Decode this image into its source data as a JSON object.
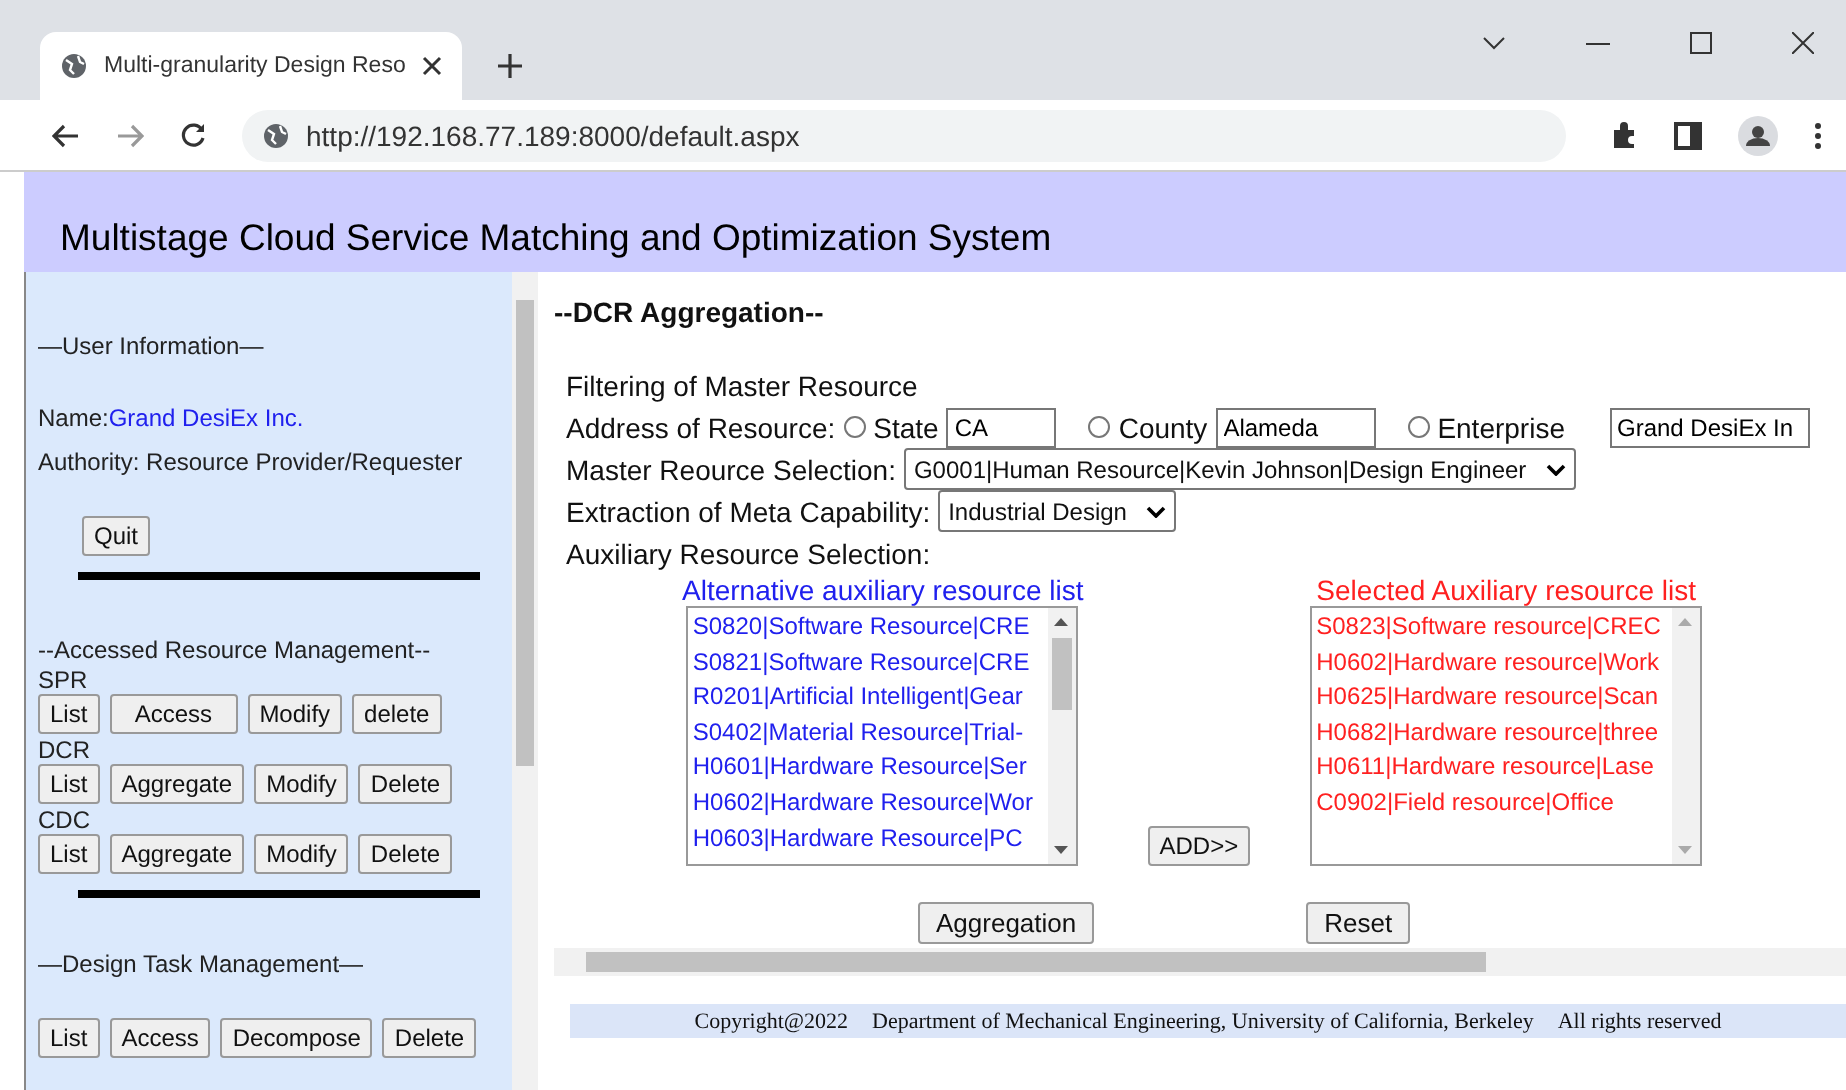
{
  "browser": {
    "tab_title": "Multi-granularity Design Reso",
    "url": "http://192.168.77.189:8000/default.aspx"
  },
  "header": {
    "title": "Multistage Cloud Service Matching and Optimization System"
  },
  "sidebar": {
    "user_heading": "—User Information—",
    "name_label": "Name:",
    "name_value": "Grand DesiEx Inc.",
    "authority": "Authority: Resource Provider/Requester",
    "quit": "Quit",
    "resource_heading": "--Accessed Resource Management--",
    "groups": [
      {
        "label": "SPR",
        "buttons": [
          "List",
          "Access",
          "Modify",
          "delete"
        ]
      },
      {
        "label": "DCR",
        "buttons": [
          "List",
          "Aggregate",
          "Modify",
          "Delete"
        ]
      },
      {
        "label": "CDC",
        "buttons": [
          "List",
          "Aggregate",
          "Modify",
          "Delete"
        ]
      }
    ],
    "task_heading": "—Design Task Management—",
    "task_buttons": [
      "List",
      "Access",
      "Decompose",
      "Delete"
    ]
  },
  "main": {
    "heading": "--DCR Aggregation--",
    "filter_label": "Filtering of Master Resource",
    "address_label": "Address of Resource:",
    "address_options": [
      {
        "label": "State",
        "selected": false,
        "value": "CA"
      },
      {
        "label": "County",
        "selected": false,
        "value": "Alameda"
      },
      {
        "label": "Enterprise",
        "selected": false,
        "value": "Grand DesiEx In"
      }
    ],
    "master_label": "Master Reource Selection:",
    "master_value": "G0001|Human Resource|Kevin Johnson|Design Engineer",
    "meta_label": "Extraction of Meta Capability:",
    "meta_value": "Industrial Design",
    "aux_label": "Auxiliary Resource Selection:",
    "alternative_title": "Alternative auxiliary resource list",
    "alternative_items": [
      "S0820|Software Resource|CRE",
      "S0821|Software Resource|CRE",
      "R0201|Artificial Intelligent|Gear",
      "S0402|Material Resource|Trial-",
      "H0601|Hardware Resource|Ser",
      "H0602|Hardware Resource|Wor",
      "H0603|Hardware Resource|PC"
    ],
    "add_button": "ADD>>",
    "selected_title": "Selected Auxiliary resource list",
    "selected_items": [
      "S0823|Software resource|CREC",
      "H0602|Hardware resource|Work",
      "H0625|Hardware resource|Scan",
      "H0682|Hardware resource|three",
      "H0611|Hardware resource|Lase",
      "C0902|Field resource|Office"
    ],
    "aggregation_button": "Aggregation",
    "reset_button": "Reset"
  },
  "footer": {
    "copyright": "Copyright@2022",
    "department": "Department of Mechanical Engineering, University of California, Berkeley",
    "rights": "All rights reserved"
  }
}
